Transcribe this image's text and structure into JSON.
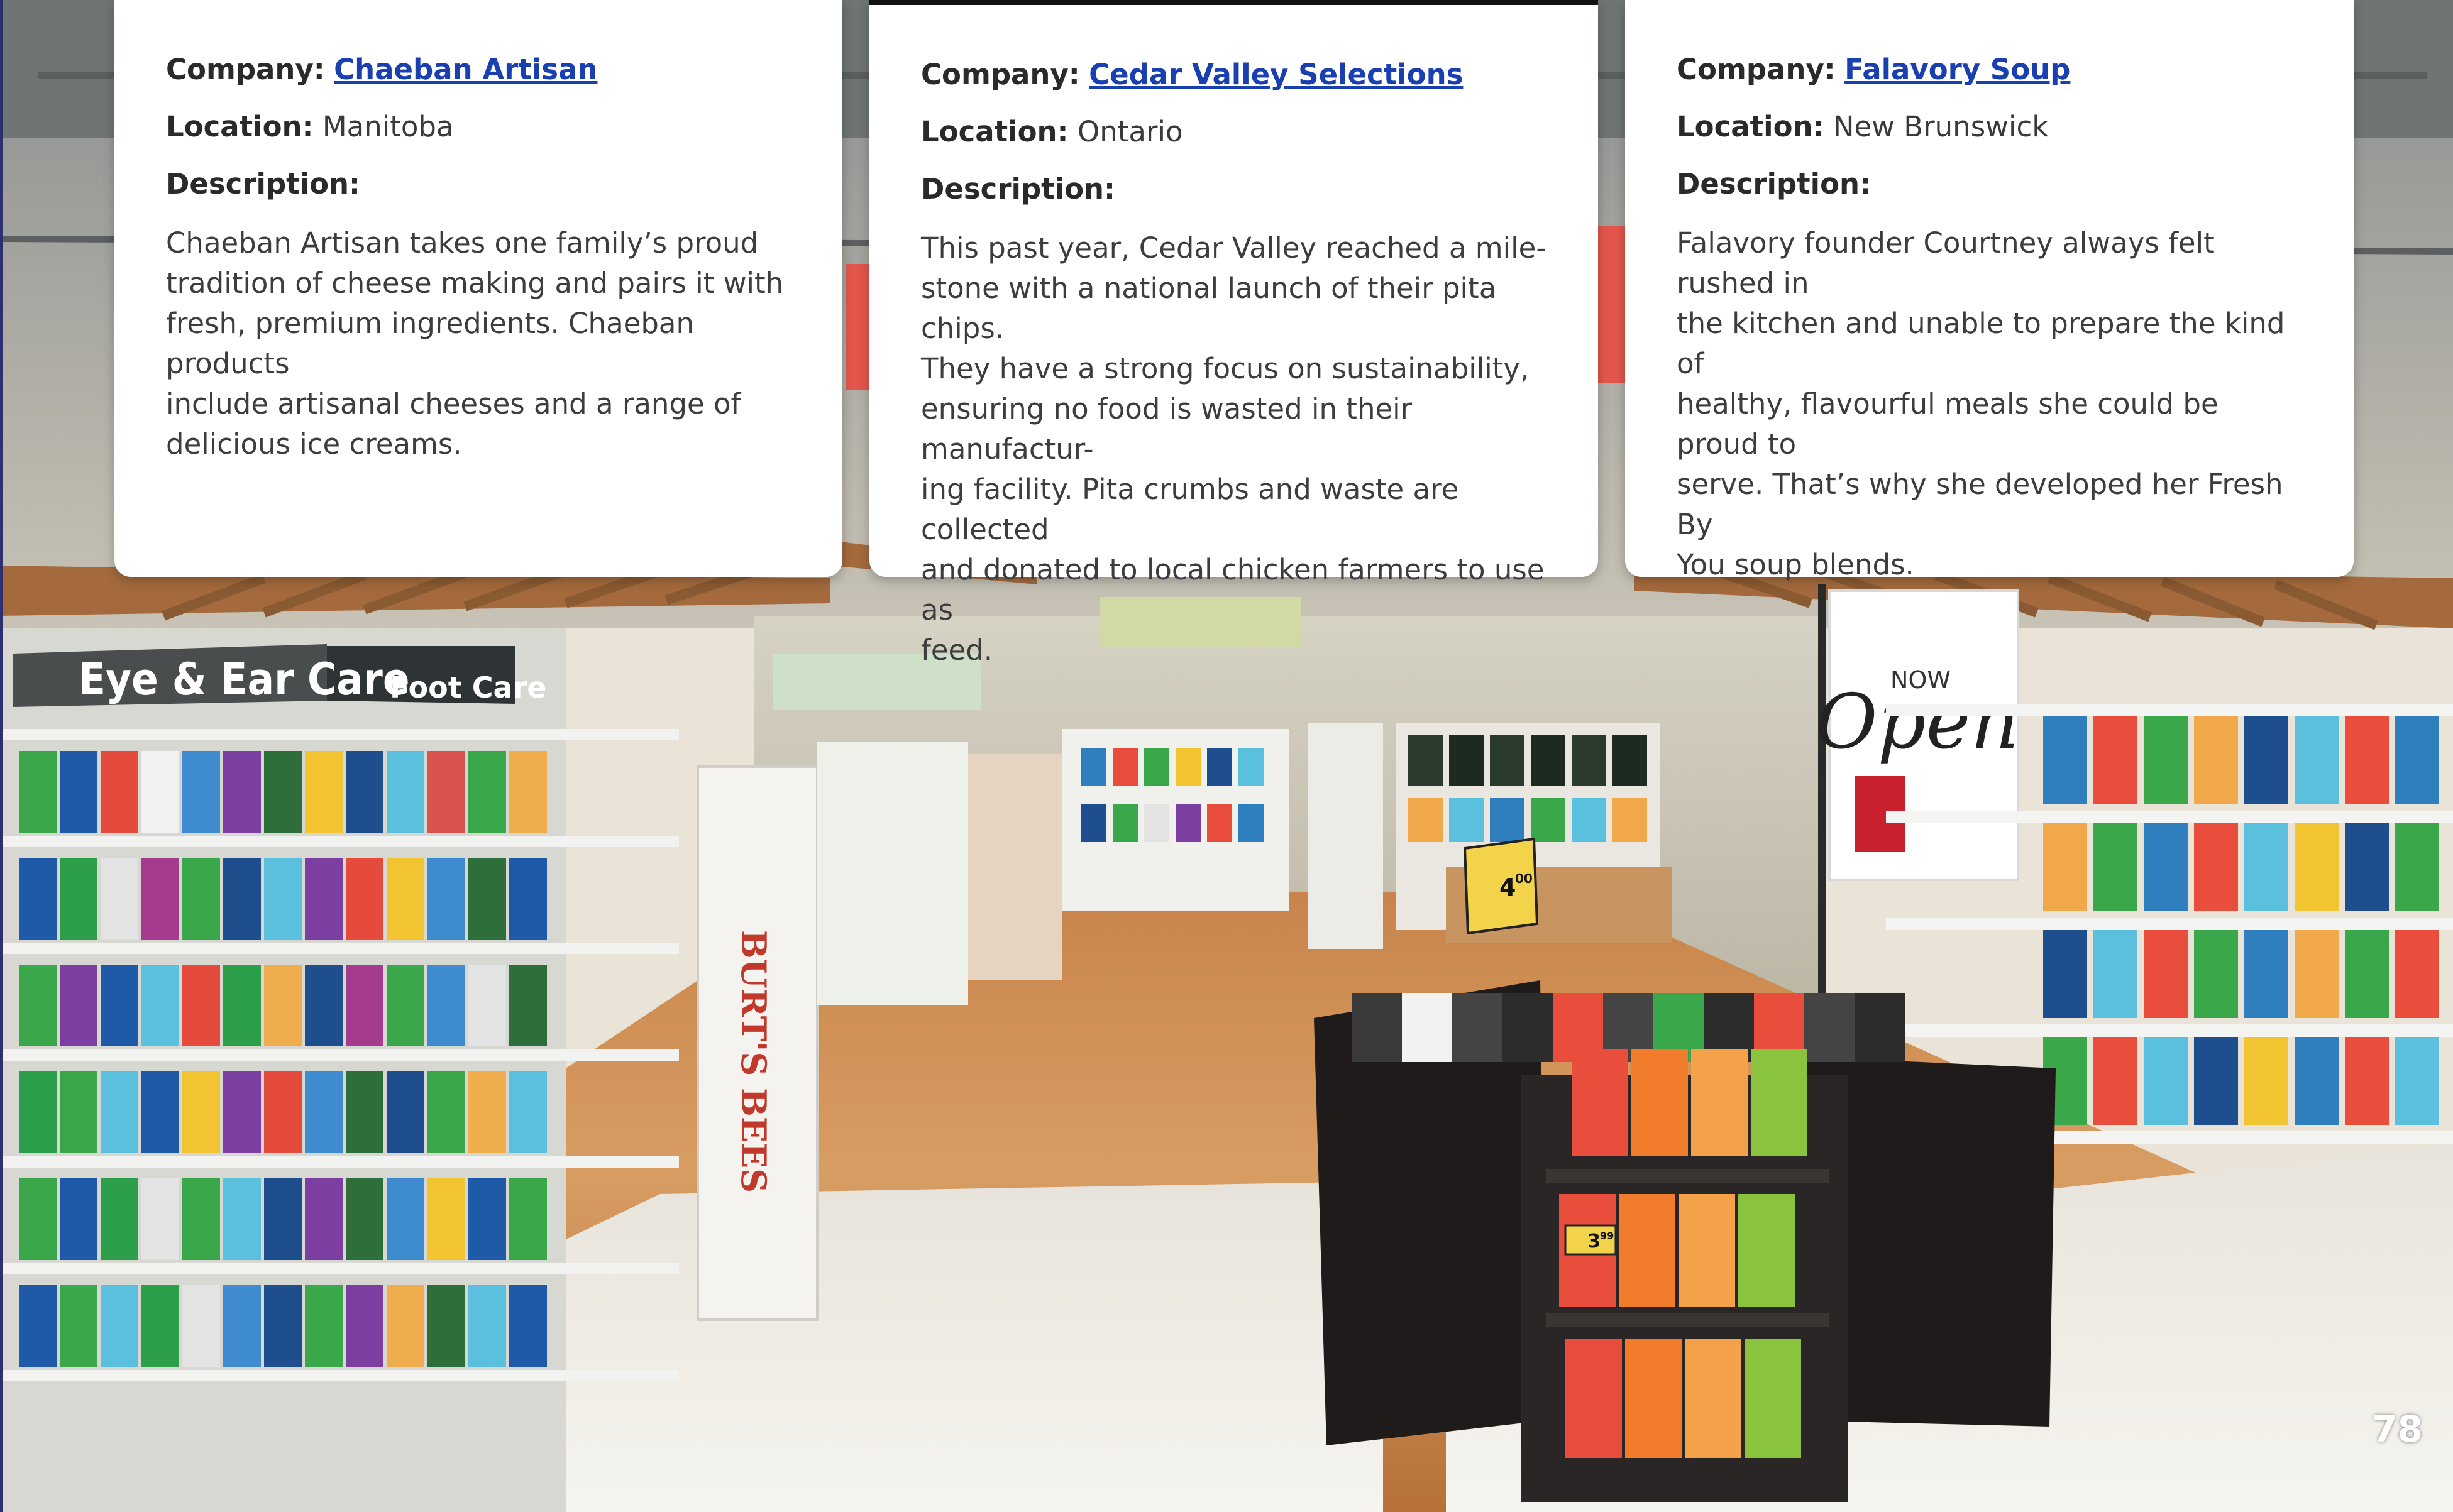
{
  "cards": [
    {
      "company_label": "Company:",
      "company_name": "Chaeban Artisan",
      "location_label": "Location:",
      "location": "Manitoba",
      "description_label": "Description:",
      "description": "Chaeban Artisan takes one family’s proud\ntradition of cheese making and pairs it with\nfresh, premium ingredients. Chaeban products\ninclude artisanal cheeses and a range of\ndelicious ice creams."
    },
    {
      "company_label": "Company:",
      "company_name": "Cedar Valley Selections",
      "location_label": "Location:",
      "location": "Ontario",
      "description_label": "Description:",
      "description": "This past year, Cedar Valley reached a mile-\nstone with a national launch of their pita chips.\nThey have a strong focus on sustainability,\nensuring no food is wasted in their manufactur-\ning facility. Pita crumbs and waste are collected\nand donated to local chicken farmers to use as\nfeed."
    },
    {
      "company_label": "Company:",
      "company_name": "Falavory Soup",
      "location_label": "Location:",
      "location": "New Brunswick",
      "description_label": "Description:",
      "description": "Falavory founder Courtney always felt rushed in\nthe kitchen and unable to prepare the kind of\nhealthy, flavourful meals she could be proud to\nserve. That’s why she developed her Fresh By\nYou soup blends."
    }
  ],
  "photo": {
    "signs": [
      "Eye & Ear Care",
      "Foot Care",
      "BURT'S BEES",
      "NOW",
      "Open",
      "3",
      "99",
      "4",
      "00"
    ]
  },
  "page_number": "78",
  "colors": {
    "link": "#1a3fb0",
    "card": "#ffffff",
    "page_number": "#ffffff"
  }
}
